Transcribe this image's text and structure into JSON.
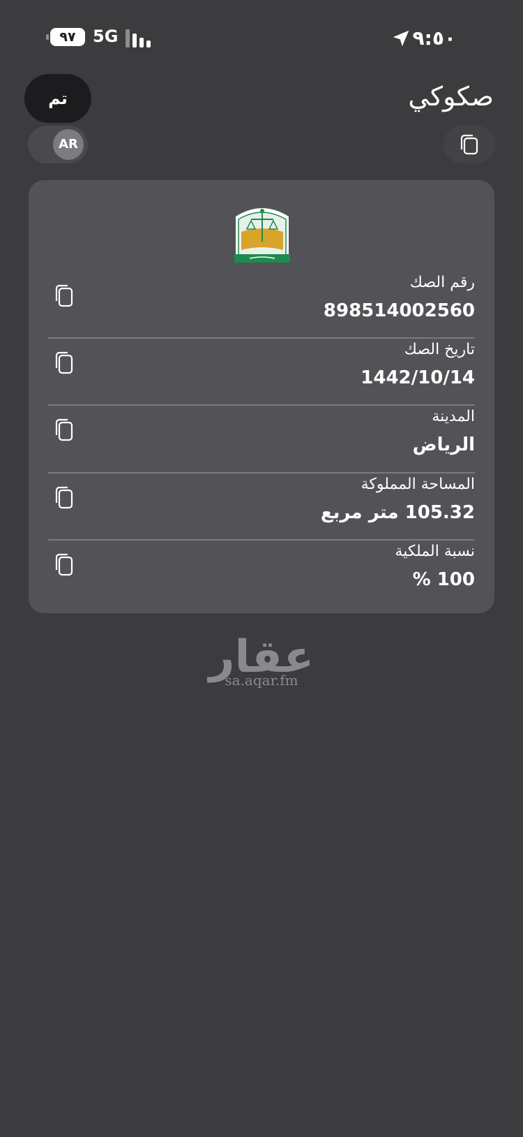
{
  "status_bar": {
    "time": "٩:٥٠",
    "battery": "٩٧",
    "network": "5G",
    "signal_level": 3,
    "signal_max": 4
  },
  "header": {
    "title": "صكوكي",
    "done_label": "تم",
    "language_label": "AR"
  },
  "deed": {
    "fields": [
      {
        "label": "رقم الصك",
        "value": "898514002560"
      },
      {
        "label": "تاريخ الصك",
        "value": "1442/10/14"
      },
      {
        "label": "المدينة",
        "value": "الرياض"
      },
      {
        "label": "المساحة المملوكة",
        "value": "105.32 متر مربع"
      },
      {
        "label": "نسبة الملكية",
        "value": "100 %"
      }
    ]
  },
  "watermark": {
    "logo_text": "عقار",
    "url": "sa.aqar.fm"
  },
  "colors": {
    "background": "#3c3b3e",
    "card": "#535256",
    "emblem_green": "#1e8a4c",
    "emblem_gold": "#d9a42b"
  }
}
